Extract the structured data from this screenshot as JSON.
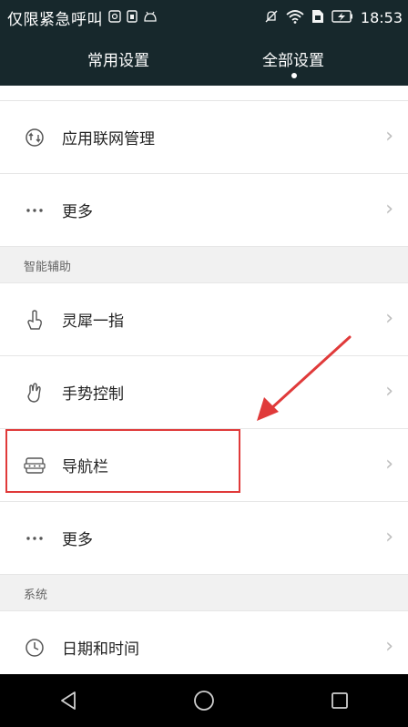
{
  "status_bar": {
    "carrier": "仅限紧急呼叫",
    "time": "18:53",
    "icons": [
      "notification-icon",
      "sim-icon",
      "android-icon",
      "mute-icon",
      "wifi-icon",
      "sim-card-icon",
      "battery-charging-icon"
    ]
  },
  "header": {
    "tabs": [
      {
        "label": "常用设置",
        "active": false
      },
      {
        "label": "全部设置",
        "active": true
      }
    ]
  },
  "list": {
    "rows_top": [
      {
        "label": "应用联网管理",
        "icon": "network-manage-icon"
      },
      {
        "label": "更多",
        "icon": "more-dots-icon"
      }
    ],
    "section_assist": "智能辅助",
    "rows_assist": [
      {
        "label": "灵犀一指",
        "icon": "knuckle-gesture-icon"
      },
      {
        "label": "手势控制",
        "icon": "hand-gesture-icon"
      },
      {
        "label": "导航栏",
        "icon": "navigation-bar-icon"
      },
      {
        "label": "更多",
        "icon": "more-dots-icon"
      }
    ],
    "section_system": "系统",
    "rows_system": [
      {
        "label": "日期和时间",
        "icon": "clock-icon"
      }
    ]
  },
  "chevron": "›",
  "colors": {
    "header_bg": "#17282c",
    "highlight": "#e03a3a",
    "list_bg": "#ffffff",
    "section_bg": "#f1f1f1"
  }
}
